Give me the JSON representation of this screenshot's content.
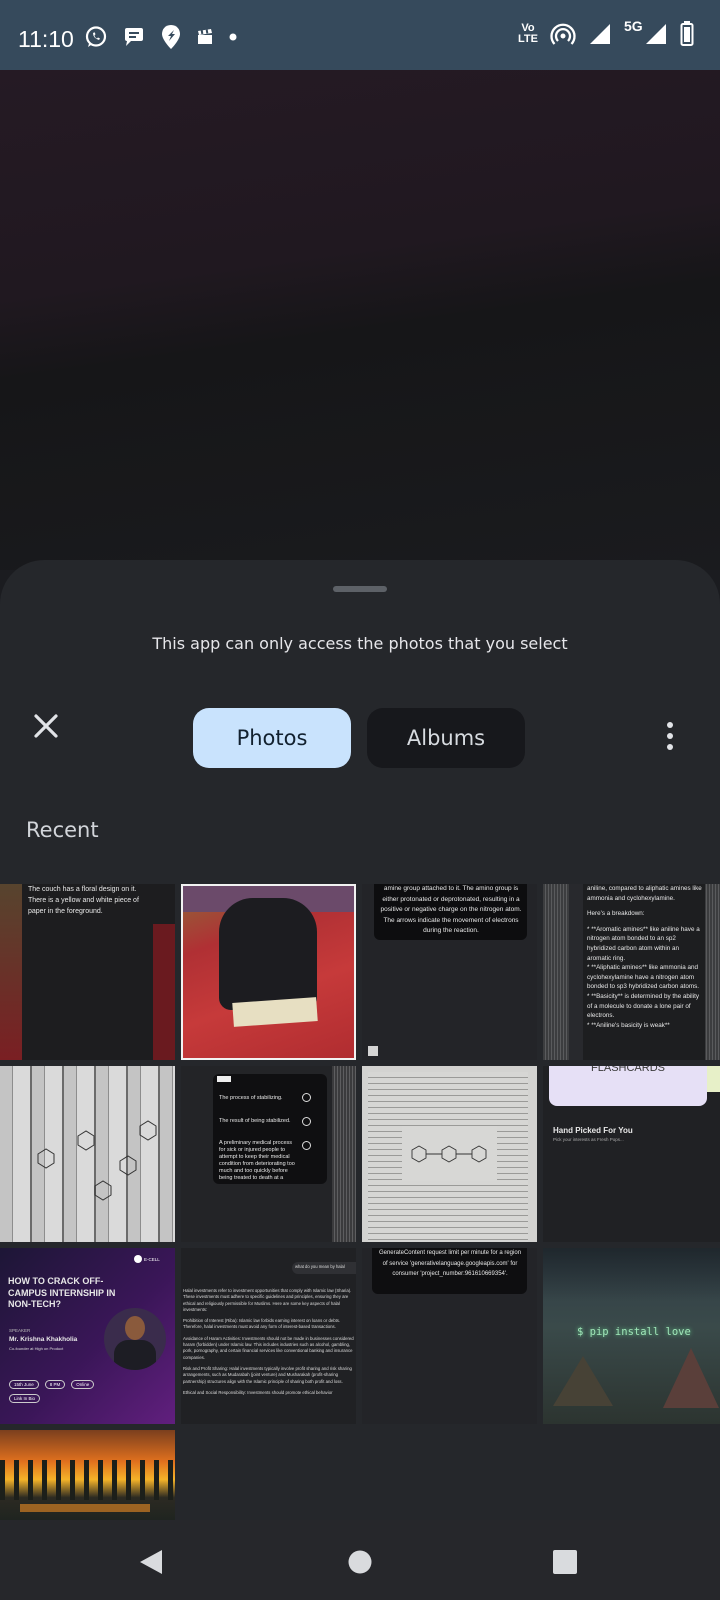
{
  "status_bar": {
    "time": "11:10",
    "network_volte_line1": "Vo",
    "network_volte_line2": "LTE",
    "network_5g": "5G",
    "left_icons": [
      "whatsapp-icon",
      "chat-icon",
      "location-pin-icon",
      "clapperboard-icon",
      "dot-icon"
    ],
    "right_icons": [
      "volte-icon",
      "hotspot-icon",
      "signal-icon",
      "5g-signal-icon",
      "battery-icon"
    ]
  },
  "picker": {
    "notice": "This app can only access the photos that you select",
    "tabs": {
      "photos": "Photos",
      "albums": "Albums"
    },
    "section_title": "Recent"
  },
  "thumbnails": {
    "t1": {
      "text": "The couch has a floral design on it. There is a yellow and white piece of paper in the foreground."
    },
    "t3": {
      "text": "amine group attached to it. The amino group is either protonated or deprotonated, resulting in a positive or negative charge on the nitrogen atom. The arrows indicate the movement of electrons during the reaction."
    },
    "t4": {
      "line1": "aniline, compared to aliphatic amines like ammonia and cyclohexylamine.",
      "line2": "Here's a breakdown:",
      "line3": "* **Aromatic amines** like aniline have a nitrogen atom bonded to an sp2 hybridized carbon atom within an aromatic ring.",
      "line4": "* **Aliphatic amines** like ammonia and cyclohexylamine have a nitrogen atom bonded to sp3 hybridized carbon atoms.",
      "line5": "* **Basicity** is determined by the ability of a molecule to donate a lone pair of electrons.",
      "line6": "* **Aniline's basicity is weak**"
    },
    "t6": {
      "opt1": "The process of stabilizing.",
      "opt2": "The result of being stabilized.",
      "opt3": "A preliminary medical process for sick or injured people to attempt to keep their medical condition from deteriorating too much and too quickly before being treated to death at a medical facility."
    },
    "t8": {
      "banner": "FLASHCARDS",
      "title": "Hand Picked For You",
      "subtitle": "Pick your interests as Fresh Pops..."
    },
    "t9": {
      "brand": "E-CELL",
      "headline": "HOW TO CRACK OFF-CAMPUS INTERNSHIP IN NON-TECH?",
      "speaker_label": "SPEAKER",
      "speaker_name": "Mr. Krishna Khakholia",
      "speaker_role": "Co-founder at High on Product",
      "pill1": "15th June",
      "pill2": "8 PM",
      "pill3": "Online",
      "pill4": "Link In Bio"
    },
    "t10": {
      "chat": "what do you mean by halal",
      "p1": "Halal investments refer to investment opportunities that comply with Islamic law (Sharia). These investments must adhere to specific guidelines and principles, ensuring they are ethical and religiously permissible for Muslims. Here are some key aspects of halal investments:",
      "p2": "Prohibition of Interest (Riba): Islamic law forbids earning interest on loans or debts. Therefore, halal investments must avoid any form of interest-based transactions.",
      "p3": "Avoidance of Haram Activities: Investments should not be made in businesses considered haram (forbidden) under Islamic law. This includes industries such as alcohol, gambling, pork, pornography, and certain financial services like conventional banking and insurance companies.",
      "p4": "Risk and Profit Sharing: Halal investments typically involve profit sharing and risk sharing arrangements, such as Mudarabah (joint venture) and Musharakah (profit-sharing partnership) structures align with the Islamic principle of sharing both profit and loss.",
      "p5": "Ethical and Social Responsibility: Investments should promote ethical behavior"
    },
    "t11": {
      "text": "GenerateContent request limit per minute for a region of service 'generativelanguage.googleapis.com' for consumer 'project_number:961610669354'."
    },
    "t12": {
      "text": "$ pip install love"
    }
  },
  "colors": {
    "status_bar": "#364a5c",
    "sheet": "#25272b",
    "tab_active": "#c9e3fd",
    "tab_inactive": "#17181c"
  },
  "nav": {
    "icons": [
      "back-icon",
      "home-icon",
      "recents-icon"
    ]
  }
}
